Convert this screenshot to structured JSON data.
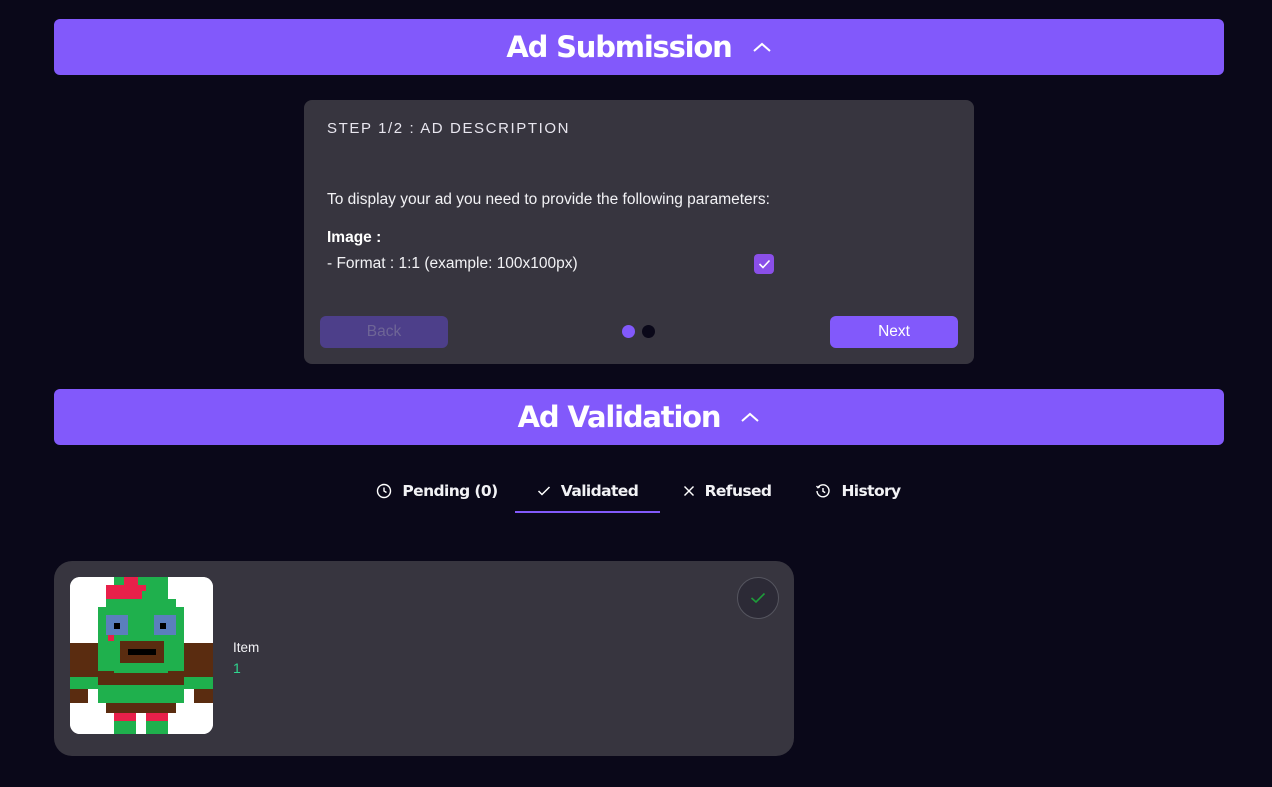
{
  "submission": {
    "title": "Ad Submission",
    "chevron_icon": "chevron-up-icon",
    "step_title": "STEP 1/2 : AD DESCRIPTION",
    "intro": "To display your ad you need to provide the following parameters:",
    "image_label": "Image :",
    "format_text": "- Format : 1:1 (example: 100x100px)",
    "format_checked": true,
    "back_label": "Back",
    "next_label": "Next",
    "current_step": 1,
    "total_steps": 2
  },
  "validation": {
    "title": "Ad Validation",
    "chevron_icon": "chevron-up-icon",
    "tabs": [
      {
        "label": "Pending (0)",
        "icon": "clock-icon",
        "active": false
      },
      {
        "label": "Validated",
        "icon": "check-icon",
        "active": true
      },
      {
        "label": "Refused",
        "icon": "close-icon",
        "active": false
      },
      {
        "label": "History",
        "icon": "history-icon",
        "active": false
      }
    ],
    "items": [
      {
        "label": "Item",
        "value": "1",
        "status": "validated",
        "status_icon": "check-icon"
      }
    ]
  },
  "colors": {
    "background": "#0a0819",
    "accent": "#8259fb",
    "card": "#37353f",
    "value_green": "#2fd68f",
    "check_purple": "#8a4fe8"
  }
}
